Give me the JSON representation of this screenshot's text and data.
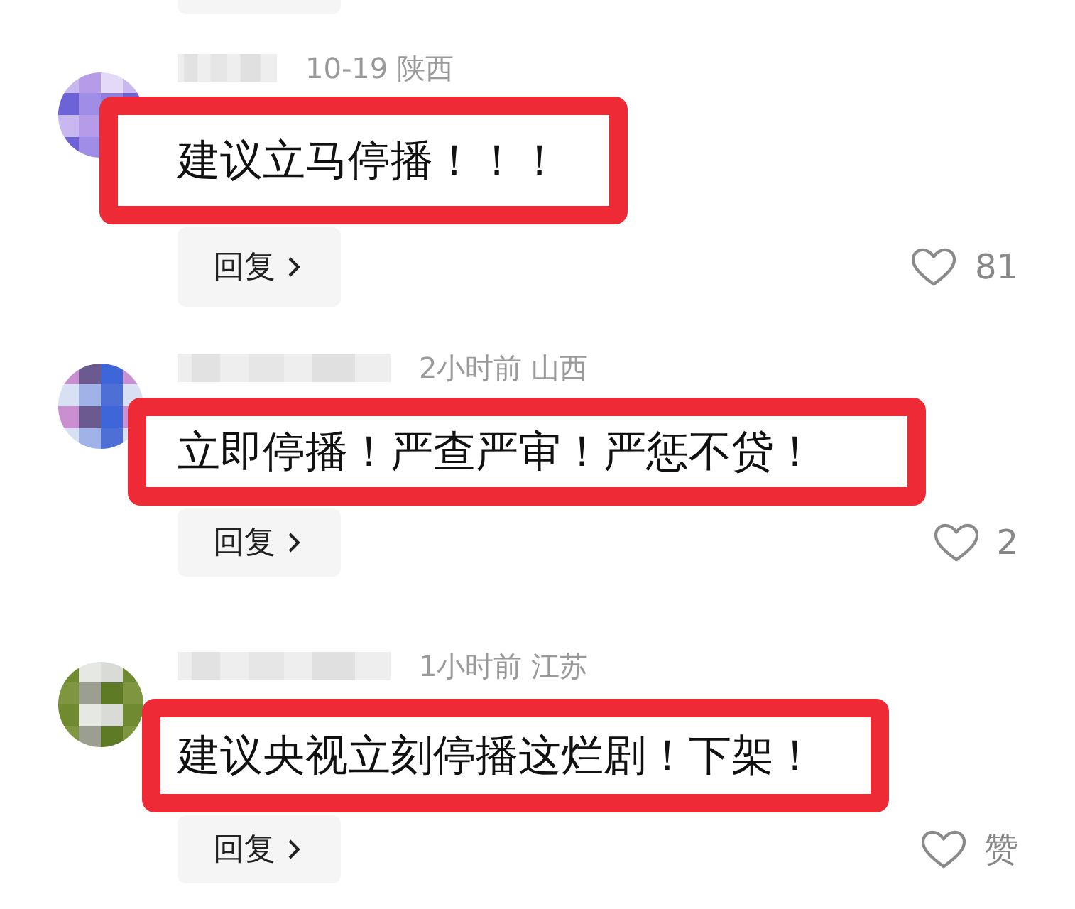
{
  "comments": [
    {
      "meta": "10-19  陕西",
      "text": "建议立马停播！！！",
      "reply": "回复",
      "likes": "81"
    },
    {
      "meta": "2小时前  山西",
      "text": "立即停播！严查严审！严惩不贷！",
      "reply": "回复",
      "likes": "2"
    },
    {
      "meta": "1小时前  江苏",
      "text": "建议央视立刻停播这烂剧！下架！",
      "reply": "回复",
      "likes": "赞"
    }
  ]
}
